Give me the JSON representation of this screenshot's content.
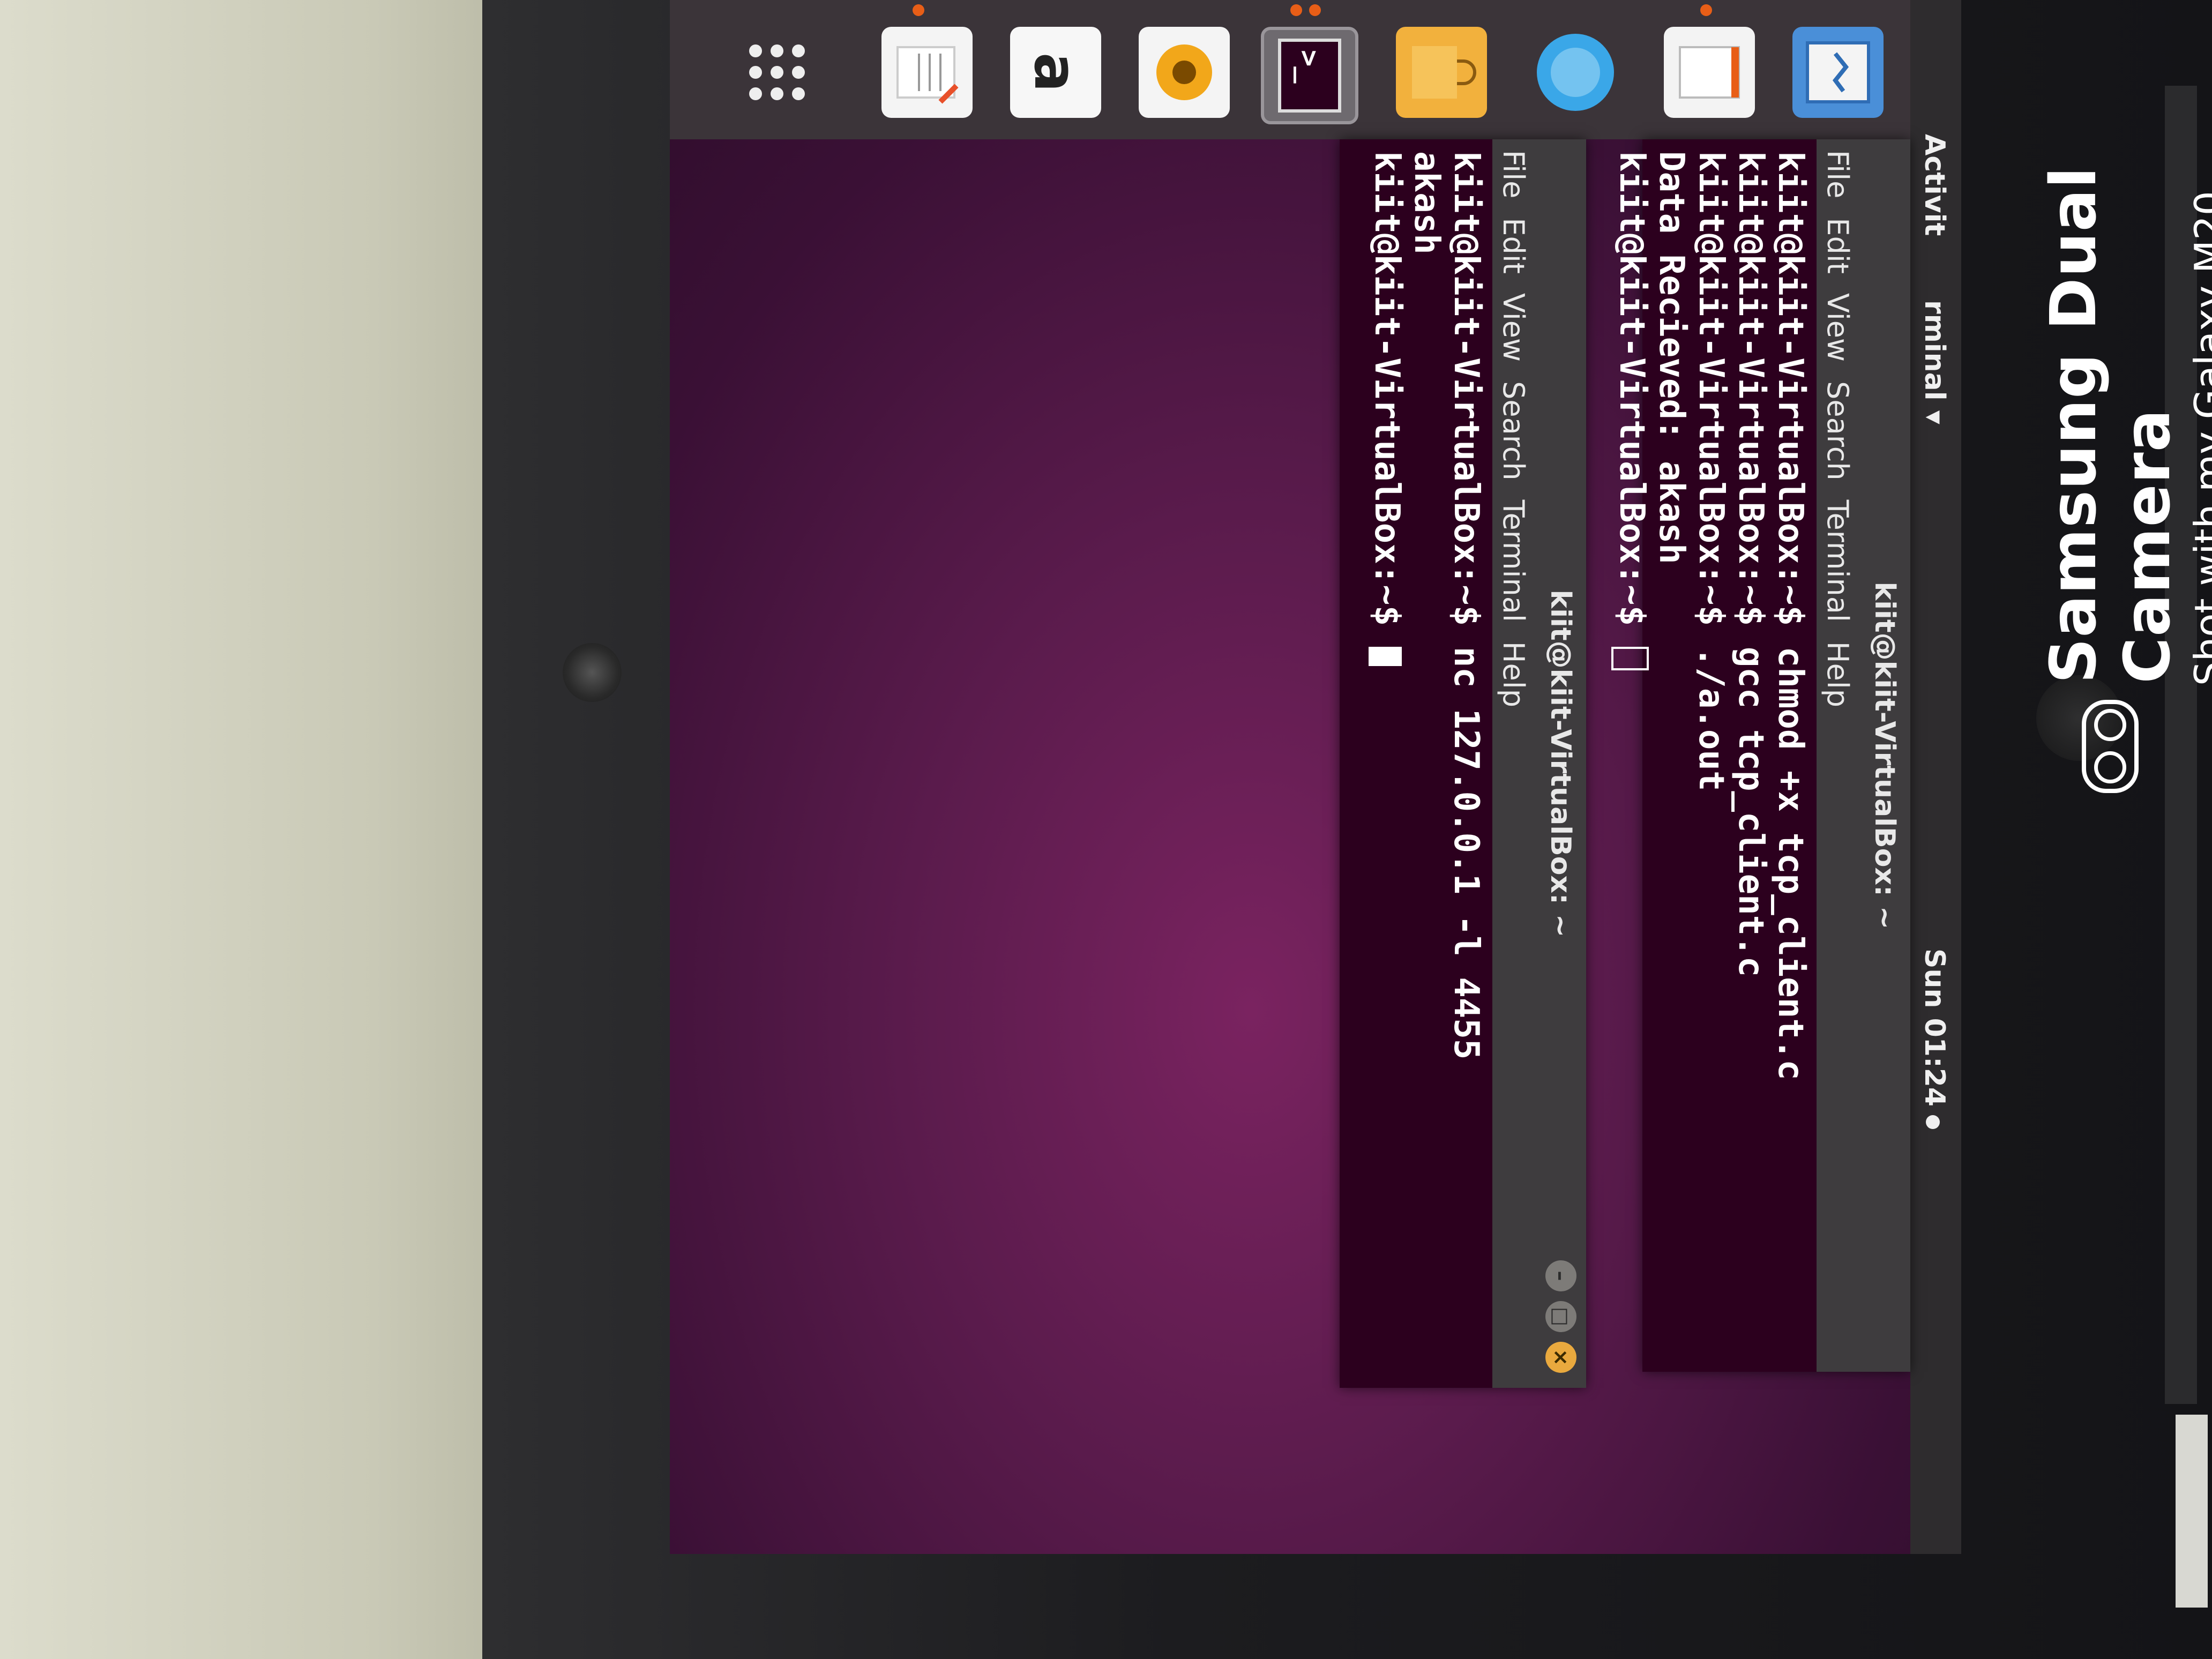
{
  "topbar": {
    "activities": "Activit",
    "app_menu": "rminal ▾",
    "clock": "Sun 01:24"
  },
  "dock": {
    "items": [
      {
        "name": "files"
      },
      {
        "name": "text-editor"
      },
      {
        "name": "web-browser"
      },
      {
        "name": "software-store"
      },
      {
        "name": "terminal",
        "glyph": ">_"
      },
      {
        "name": "rhythmbox"
      },
      {
        "name": "amazon",
        "glyph": "a"
      },
      {
        "name": "notes"
      },
      {
        "name": "show-applications"
      }
    ]
  },
  "terminal_back": {
    "title": "kiit@kiit-VirtualBox: ~",
    "menu": [
      "File",
      "Edit",
      "View",
      "Search",
      "Terminal",
      "Help"
    ],
    "lines": [
      "kiit@kiit-VirtualBox:~$ chmod +x tcp_client.c",
      "kiit@kiit-VirtualBox:~$ gcc tcp_client.c",
      "kiit@kiit-VirtualBox:~$ ./a.out",
      "Data Recieved: akash",
      "kiit@kiit-VirtualBox:~$ "
    ]
  },
  "terminal_front": {
    "title": "kiit@kiit-VirtualBox: ~",
    "menu": [
      "File",
      "Edit",
      "View",
      "Search",
      "Terminal",
      "Help"
    ],
    "lines": [
      "kiit@kiit-VirtualBox:~$ nc 127.0.0.1 -l 4455",
      "akash",
      "kiit@kiit-VirtualBox:~$ "
    ],
    "buttons": {
      "minimize": "–",
      "maximize": "□",
      "close": "×"
    }
  },
  "watermark": {
    "brand": "Samsung Dual Camera",
    "subtitle": "Shot with my Galaxy M20"
  },
  "colors": {
    "desktop_bg": "#5a1b4c",
    "terminal_bg": "#2c001e",
    "accent": "#e85e17"
  }
}
